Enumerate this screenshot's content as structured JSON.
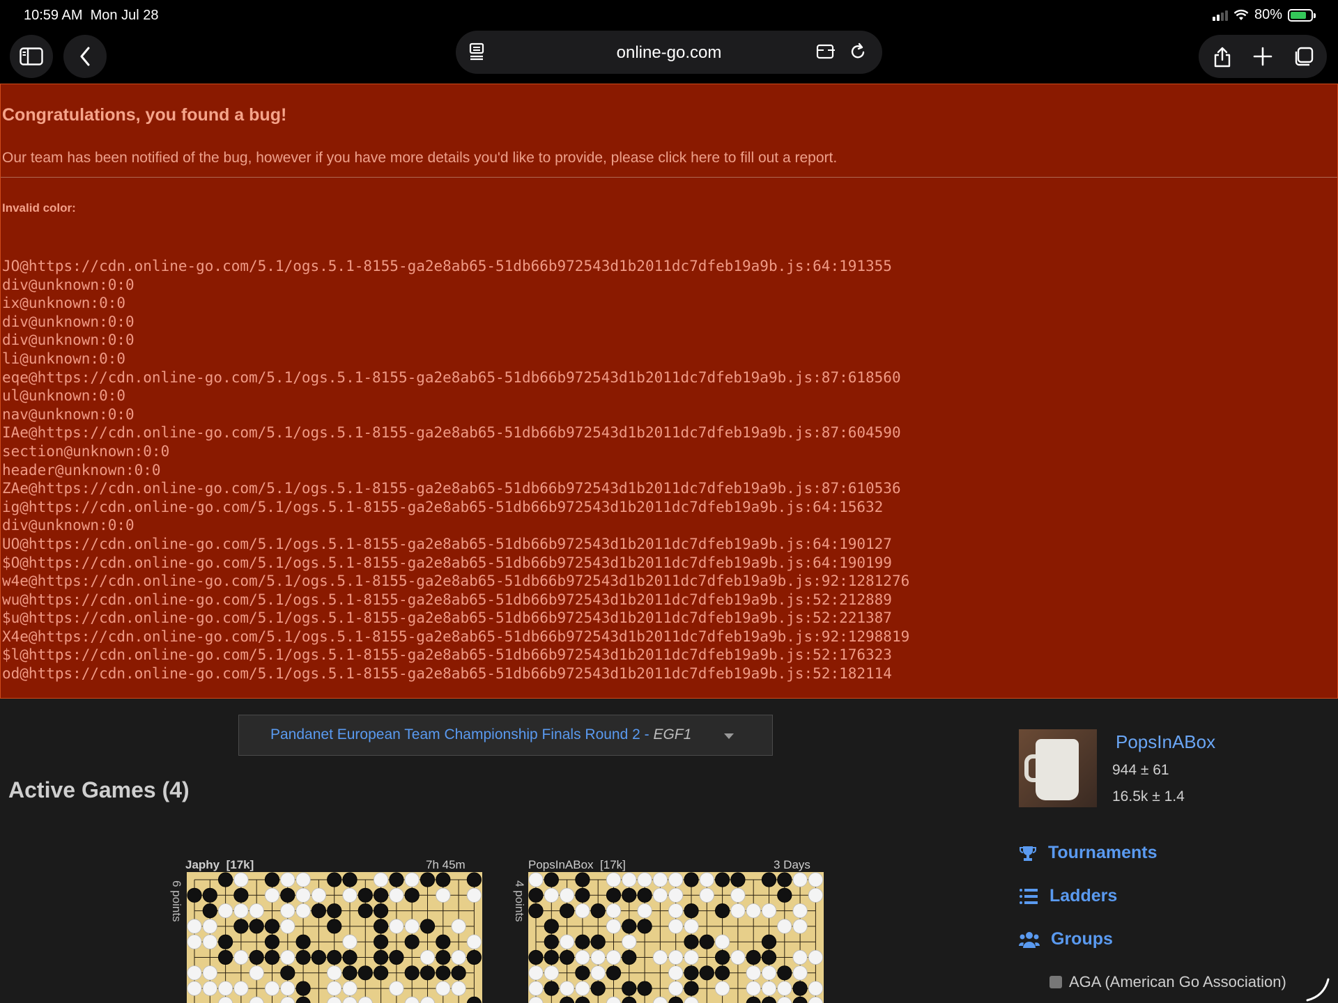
{
  "status": {
    "time": "10:59 AM",
    "date": "Mon Jul 28",
    "battery": "80%",
    "battery_level": 0.8
  },
  "browser": {
    "url": "online-go.com"
  },
  "bug": {
    "title": "Congratulations, you found a bug!",
    "intro": "Our team has been notified of the bug, however if you have more details you'd like to provide, please click here to fill out a report.",
    "error_title": "Invalid color:",
    "stack": [
      "JO@https://cdn.online-go.com/5.1/ogs.5.1-8155-ga2e8ab65-51db66b972543d1b2011dc7dfeb19a9b.js:64:191355",
      "div@unknown:0:0",
      "ix@unknown:0:0",
      "div@unknown:0:0",
      "div@unknown:0:0",
      "li@unknown:0:0",
      "eqe@https://cdn.online-go.com/5.1/ogs.5.1-8155-ga2e8ab65-51db66b972543d1b2011dc7dfeb19a9b.js:87:618560",
      "ul@unknown:0:0",
      "nav@unknown:0:0",
      "IAe@https://cdn.online-go.com/5.1/ogs.5.1-8155-ga2e8ab65-51db66b972543d1b2011dc7dfeb19a9b.js:87:604590",
      "section@unknown:0:0",
      "header@unknown:0:0",
      "ZAe@https://cdn.online-go.com/5.1/ogs.5.1-8155-ga2e8ab65-51db66b972543d1b2011dc7dfeb19a9b.js:87:610536",
      "ig@https://cdn.online-go.com/5.1/ogs.5.1-8155-ga2e8ab65-51db66b972543d1b2011dc7dfeb19a9b.js:64:15632",
      "div@unknown:0:0",
      "UO@https://cdn.online-go.com/5.1/ogs.5.1-8155-ga2e8ab65-51db66b972543d1b2011dc7dfeb19a9b.js:64:190127",
      "$O@https://cdn.online-go.com/5.1/ogs.5.1-8155-ga2e8ab65-51db66b972543d1b2011dc7dfeb19a9b.js:64:190199",
      "w4e@https://cdn.online-go.com/5.1/ogs.5.1-8155-ga2e8ab65-51db66b972543d1b2011dc7dfeb19a9b.js:92:1281276",
      "wu@https://cdn.online-go.com/5.1/ogs.5.1-8155-ga2e8ab65-51db66b972543d1b2011dc7dfeb19a9b.js:52:212889",
      "$u@https://cdn.online-go.com/5.1/ogs.5.1-8155-ga2e8ab65-51db66b972543d1b2011dc7dfeb19a9b.js:52:221387",
      "X4e@https://cdn.online-go.com/5.1/ogs.5.1-8155-ga2e8ab65-51db66b972543d1b2011dc7dfeb19a9b.js:92:1298819",
      "$l@https://cdn.online-go.com/5.1/ogs.5.1-8155-ga2e8ab65-51db66b972543d1b2011dc7dfeb19a9b.js:52:176323",
      "od@https://cdn.online-go.com/5.1/ogs.5.1-8155-ga2e8ab65-51db66b972543d1b2011dc7dfeb19a9b.js:52:182114"
    ]
  },
  "event_selector": {
    "event": "Pandanet European Team Championship Finals Round 2",
    "separator": " - ",
    "group": "EGF1"
  },
  "active_games": {
    "title": "Active Games (4)",
    "games": [
      {
        "opponent": "Japhy",
        "rank": "[17k]",
        "clock": "7h 45m",
        "points": "6 points"
      },
      {
        "opponent": "PopsInABox",
        "rank": "[17k]",
        "clock": "3 Days",
        "points": "4 points"
      }
    ]
  },
  "profile": {
    "username": "PopsInABox",
    "rating": "944 ± 61",
    "rank": "16.5k ± 1.4"
  },
  "nav": {
    "tournaments": "Tournaments",
    "ladders": "Ladders",
    "groups": "Groups",
    "group_item": "AGA (American Go Association)"
  },
  "icons": [
    "sidebar-icon",
    "back-icon",
    "reader-icon",
    "extension-icon",
    "reload-icon",
    "share-icon",
    "plus-icon",
    "tabs-icon",
    "trophy-icon",
    "list-icon",
    "users-icon"
  ]
}
